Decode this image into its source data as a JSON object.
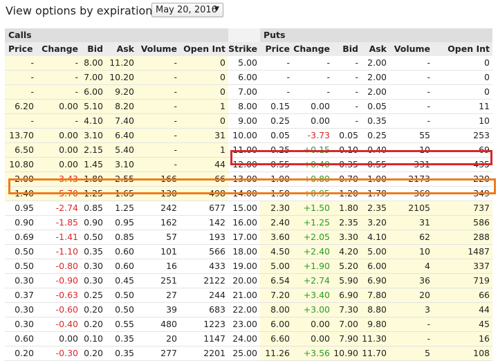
{
  "header": {
    "title": "View options by expiration",
    "expiration": "May 20, 2016"
  },
  "sections": {
    "calls": "Calls",
    "puts": "Puts"
  },
  "columns": {
    "calls": [
      "Price",
      "Change",
      "Bid",
      "Ask",
      "Volume",
      "Open Int"
    ],
    "strike": "Strike",
    "puts": [
      "Price",
      "Change",
      "Bid",
      "Ask",
      "Volume",
      "Open Int"
    ]
  },
  "rows": [
    {
      "c": [
        "-",
        "-",
        "8.00",
        "11.20",
        "-",
        "0"
      ],
      "s": "5.00",
      "p": [
        "-",
        "-",
        "-",
        "2.00",
        "-",
        "0"
      ],
      "citm": true,
      "pitm": false
    },
    {
      "c": [
        "-",
        "-",
        "7.00",
        "10.20",
        "-",
        "0"
      ],
      "s": "6.00",
      "p": [
        "-",
        "-",
        "-",
        "2.00",
        "-",
        "0"
      ],
      "citm": true,
      "pitm": false
    },
    {
      "c": [
        "-",
        "-",
        "6.00",
        "9.20",
        "-",
        "0"
      ],
      "s": "7.00",
      "p": [
        "-",
        "-",
        "-",
        "2.00",
        "-",
        "0"
      ],
      "citm": true,
      "pitm": false
    },
    {
      "c": [
        "6.20",
        "0.00",
        "5.10",
        "8.20",
        "-",
        "1"
      ],
      "s": "8.00",
      "p": [
        "0.15",
        "0.00",
        "-",
        "0.05",
        "-",
        "11"
      ],
      "citm": true,
      "pitm": false
    },
    {
      "c": [
        "-",
        "-",
        "4.10",
        "7.40",
        "-",
        "0"
      ],
      "s": "9.00",
      "p": [
        "0.25",
        "0.00",
        "-",
        "0.35",
        "-",
        "10"
      ],
      "citm": true,
      "pitm": false
    },
    {
      "c": [
        "13.70",
        "0.00",
        "3.10",
        "6.40",
        "-",
        "31"
      ],
      "s": "10.00",
      "p": [
        "0.05",
        "-3.73",
        "0.05",
        "0.25",
        "55",
        "253"
      ],
      "citm": true,
      "pitm": false
    },
    {
      "c": [
        "6.50",
        "0.00",
        "2.15",
        "5.40",
        "-",
        "1"
      ],
      "s": "11.00",
      "p": [
        "0.25",
        "+0.15",
        "0.10",
        "0.40",
        "10",
        "69"
      ],
      "citm": true,
      "pitm": false
    },
    {
      "c": [
        "10.80",
        "0.00",
        "1.45",
        "3.10",
        "-",
        "44"
      ],
      "s": "12.00",
      "p": [
        "0.55",
        "+0.40",
        "0.35",
        "0.55",
        "331",
        "435"
      ],
      "citm": true,
      "pitm": false
    },
    {
      "c": [
        "2.00",
        "-3.43",
        "1.80",
        "2.55",
        "166",
        "66"
      ],
      "s": "13.00",
      "p": [
        "1.00",
        "+0.80",
        "0.70",
        "1.00",
        "2173",
        "220"
      ],
      "citm": true,
      "pitm": false
    },
    {
      "c": [
        "1.40",
        "-5.70",
        "1.25",
        "1.65",
        "130",
        "498"
      ],
      "s": "14.00",
      "p": [
        "1.50",
        "+0.95",
        "1.20",
        "1.70",
        "369",
        "349"
      ],
      "citm": true,
      "pitm": false
    },
    {
      "c": [
        "0.95",
        "-2.74",
        "0.85",
        "1.25",
        "242",
        "677"
      ],
      "s": "15.00",
      "p": [
        "2.30",
        "+1.50",
        "1.80",
        "2.35",
        "2105",
        "737"
      ],
      "citm": false,
      "pitm": true
    },
    {
      "c": [
        "0.90",
        "-1.85",
        "0.90",
        "0.95",
        "162",
        "142"
      ],
      "s": "16.00",
      "p": [
        "2.40",
        "+1.25",
        "2.35",
        "3.20",
        "31",
        "586"
      ],
      "citm": false,
      "pitm": true
    },
    {
      "c": [
        "0.69",
        "-1.41",
        "0.50",
        "0.85",
        "57",
        "193"
      ],
      "s": "17.00",
      "p": [
        "3.60",
        "+2.05",
        "3.30",
        "4.10",
        "62",
        "288"
      ],
      "citm": false,
      "pitm": true
    },
    {
      "c": [
        "0.50",
        "-1.10",
        "0.35",
        "0.60",
        "101",
        "566"
      ],
      "s": "18.00",
      "p": [
        "4.50",
        "+2.40",
        "4.20",
        "5.00",
        "10",
        "1487"
      ],
      "citm": false,
      "pitm": true
    },
    {
      "c": [
        "0.50",
        "-0.80",
        "0.30",
        "0.60",
        "16",
        "433"
      ],
      "s": "19.00",
      "p": [
        "5.00",
        "+1.90",
        "5.20",
        "6.00",
        "4",
        "337"
      ],
      "citm": false,
      "pitm": true
    },
    {
      "c": [
        "0.30",
        "-0.90",
        "0.30",
        "0.45",
        "251",
        "2122"
      ],
      "s": "20.00",
      "p": [
        "6.54",
        "+2.74",
        "5.90",
        "6.90",
        "36",
        "719"
      ],
      "citm": false,
      "pitm": true
    },
    {
      "c": [
        "0.37",
        "-0.63",
        "0.25",
        "0.50",
        "27",
        "244"
      ],
      "s": "21.00",
      "p": [
        "7.20",
        "+3.40",
        "6.90",
        "7.80",
        "20",
        "66"
      ],
      "citm": false,
      "pitm": true
    },
    {
      "c": [
        "0.30",
        "-0.60",
        "0.20",
        "0.50",
        "39",
        "683"
      ],
      "s": "22.00",
      "p": [
        "8.00",
        "+3.00",
        "7.30",
        "8.80",
        "3",
        "44"
      ],
      "citm": false,
      "pitm": true
    },
    {
      "c": [
        "0.30",
        "-0.40",
        "0.20",
        "0.55",
        "480",
        "1223"
      ],
      "s": "23.00",
      "p": [
        "6.00",
        "0.00",
        "7.00",
        "9.80",
        "-",
        "45"
      ],
      "citm": false,
      "pitm": true
    },
    {
      "c": [
        "0.60",
        "0.00",
        "0.10",
        "0.35",
        "20",
        "1147"
      ],
      "s": "24.00",
      "p": [
        "6.60",
        "0.00",
        "7.90",
        "11.30",
        "-",
        "16"
      ],
      "citm": false,
      "pitm": true
    },
    {
      "c": [
        "0.20",
        "-0.30",
        "0.20",
        "0.35",
        "277",
        "2201"
      ],
      "s": "25.00",
      "p": [
        "11.26",
        "+3.56",
        "10.90",
        "11.70",
        "5",
        "108"
      ],
      "citm": false,
      "pitm": true
    }
  ],
  "colors": {
    "itm": "#fdfbd9",
    "negative": "#d9262a",
    "positive": "#2a9a2a",
    "highlight_red": "#d9262a",
    "highlight_orange": "#f07a1a"
  }
}
